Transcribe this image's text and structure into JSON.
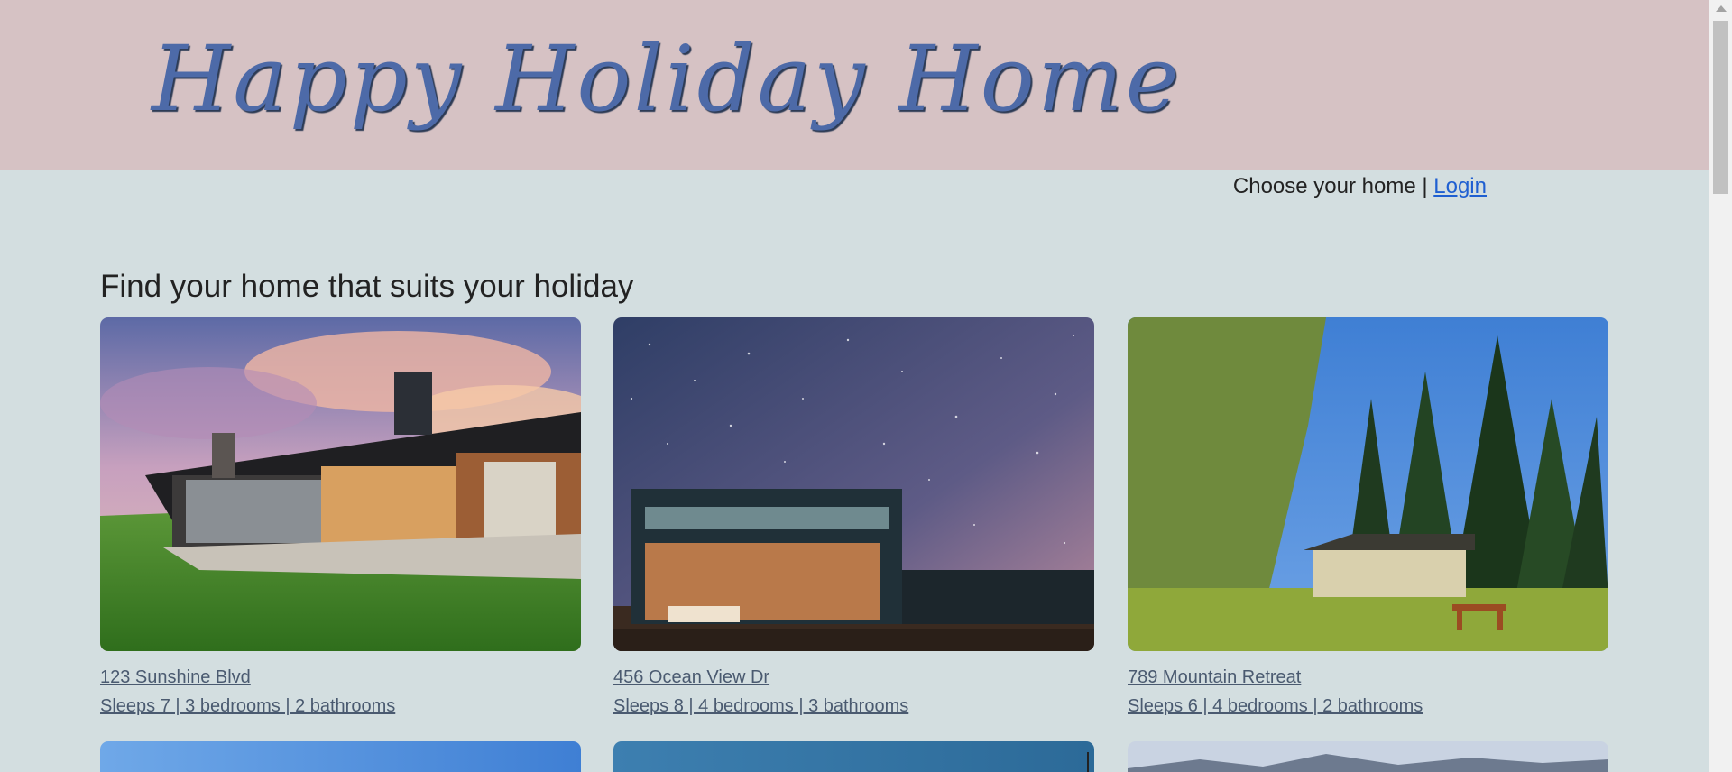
{
  "header": {
    "site_title": "Happy Holiday Home"
  },
  "nav": {
    "text": "Choose your home | ",
    "login_label": "Login"
  },
  "main": {
    "heading": "Find your home that suits your holiday",
    "listings": [
      {
        "address": "123 Sunshine Blvd",
        "details": "Sleeps 7 | 3 bedrooms | 2 bathrooms"
      },
      {
        "address": "456 Ocean View Dr",
        "details": "Sleeps 8 | 4 bedrooms | 3 bathrooms"
      },
      {
        "address": "789 Mountain Retreat",
        "details": "Sleeps 6 | 4 bedrooms | 2 bathrooms"
      }
    ]
  },
  "colors": {
    "banner": "#d6c2c4",
    "page_bg": "#d3dee0",
    "title": "#4d6aa8",
    "link": "#1f5fd1"
  }
}
